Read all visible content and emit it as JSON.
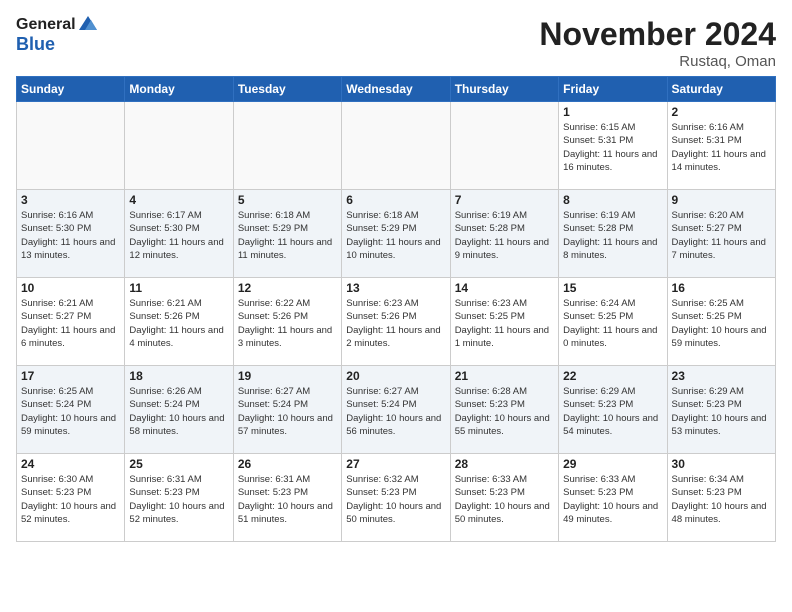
{
  "header": {
    "logo_general": "General",
    "logo_blue": "Blue",
    "month_title": "November 2024",
    "location": "Rustaq, Oman"
  },
  "weekdays": [
    "Sunday",
    "Monday",
    "Tuesday",
    "Wednesday",
    "Thursday",
    "Friday",
    "Saturday"
  ],
  "weeks": [
    [
      {
        "day": "",
        "info": ""
      },
      {
        "day": "",
        "info": ""
      },
      {
        "day": "",
        "info": ""
      },
      {
        "day": "",
        "info": ""
      },
      {
        "day": "",
        "info": ""
      },
      {
        "day": "1",
        "info": "Sunrise: 6:15 AM\nSunset: 5:31 PM\nDaylight: 11 hours and 16 minutes."
      },
      {
        "day": "2",
        "info": "Sunrise: 6:16 AM\nSunset: 5:31 PM\nDaylight: 11 hours and 14 minutes."
      }
    ],
    [
      {
        "day": "3",
        "info": "Sunrise: 6:16 AM\nSunset: 5:30 PM\nDaylight: 11 hours and 13 minutes."
      },
      {
        "day": "4",
        "info": "Sunrise: 6:17 AM\nSunset: 5:30 PM\nDaylight: 11 hours and 12 minutes."
      },
      {
        "day": "5",
        "info": "Sunrise: 6:18 AM\nSunset: 5:29 PM\nDaylight: 11 hours and 11 minutes."
      },
      {
        "day": "6",
        "info": "Sunrise: 6:18 AM\nSunset: 5:29 PM\nDaylight: 11 hours and 10 minutes."
      },
      {
        "day": "7",
        "info": "Sunrise: 6:19 AM\nSunset: 5:28 PM\nDaylight: 11 hours and 9 minutes."
      },
      {
        "day": "8",
        "info": "Sunrise: 6:19 AM\nSunset: 5:28 PM\nDaylight: 11 hours and 8 minutes."
      },
      {
        "day": "9",
        "info": "Sunrise: 6:20 AM\nSunset: 5:27 PM\nDaylight: 11 hours and 7 minutes."
      }
    ],
    [
      {
        "day": "10",
        "info": "Sunrise: 6:21 AM\nSunset: 5:27 PM\nDaylight: 11 hours and 6 minutes."
      },
      {
        "day": "11",
        "info": "Sunrise: 6:21 AM\nSunset: 5:26 PM\nDaylight: 11 hours and 4 minutes."
      },
      {
        "day": "12",
        "info": "Sunrise: 6:22 AM\nSunset: 5:26 PM\nDaylight: 11 hours and 3 minutes."
      },
      {
        "day": "13",
        "info": "Sunrise: 6:23 AM\nSunset: 5:26 PM\nDaylight: 11 hours and 2 minutes."
      },
      {
        "day": "14",
        "info": "Sunrise: 6:23 AM\nSunset: 5:25 PM\nDaylight: 11 hours and 1 minute."
      },
      {
        "day": "15",
        "info": "Sunrise: 6:24 AM\nSunset: 5:25 PM\nDaylight: 11 hours and 0 minutes."
      },
      {
        "day": "16",
        "info": "Sunrise: 6:25 AM\nSunset: 5:25 PM\nDaylight: 10 hours and 59 minutes."
      }
    ],
    [
      {
        "day": "17",
        "info": "Sunrise: 6:25 AM\nSunset: 5:24 PM\nDaylight: 10 hours and 59 minutes."
      },
      {
        "day": "18",
        "info": "Sunrise: 6:26 AM\nSunset: 5:24 PM\nDaylight: 10 hours and 58 minutes."
      },
      {
        "day": "19",
        "info": "Sunrise: 6:27 AM\nSunset: 5:24 PM\nDaylight: 10 hours and 57 minutes."
      },
      {
        "day": "20",
        "info": "Sunrise: 6:27 AM\nSunset: 5:24 PM\nDaylight: 10 hours and 56 minutes."
      },
      {
        "day": "21",
        "info": "Sunrise: 6:28 AM\nSunset: 5:23 PM\nDaylight: 10 hours and 55 minutes."
      },
      {
        "day": "22",
        "info": "Sunrise: 6:29 AM\nSunset: 5:23 PM\nDaylight: 10 hours and 54 minutes."
      },
      {
        "day": "23",
        "info": "Sunrise: 6:29 AM\nSunset: 5:23 PM\nDaylight: 10 hours and 53 minutes."
      }
    ],
    [
      {
        "day": "24",
        "info": "Sunrise: 6:30 AM\nSunset: 5:23 PM\nDaylight: 10 hours and 52 minutes."
      },
      {
        "day": "25",
        "info": "Sunrise: 6:31 AM\nSunset: 5:23 PM\nDaylight: 10 hours and 52 minutes."
      },
      {
        "day": "26",
        "info": "Sunrise: 6:31 AM\nSunset: 5:23 PM\nDaylight: 10 hours and 51 minutes."
      },
      {
        "day": "27",
        "info": "Sunrise: 6:32 AM\nSunset: 5:23 PM\nDaylight: 10 hours and 50 minutes."
      },
      {
        "day": "28",
        "info": "Sunrise: 6:33 AM\nSunset: 5:23 PM\nDaylight: 10 hours and 50 minutes."
      },
      {
        "day": "29",
        "info": "Sunrise: 6:33 AM\nSunset: 5:23 PM\nDaylight: 10 hours and 49 minutes."
      },
      {
        "day": "30",
        "info": "Sunrise: 6:34 AM\nSunset: 5:23 PM\nDaylight: 10 hours and 48 minutes."
      }
    ]
  ]
}
